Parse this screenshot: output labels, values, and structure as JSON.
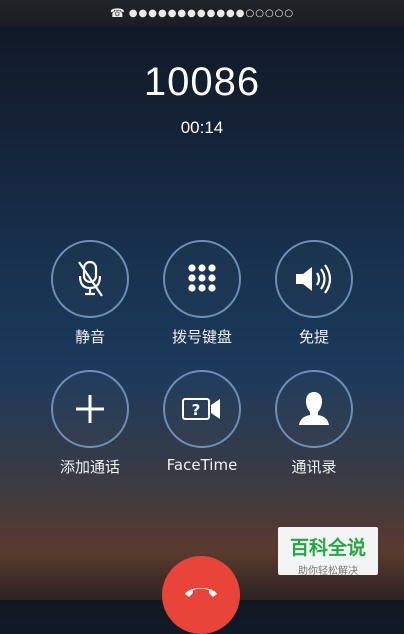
{
  "status_bar": {
    "icon": "phone-handset-icon",
    "signal_dots": "●●●●●●●●●●●●○○○○○"
  },
  "call": {
    "number": "10086",
    "duration": "00:14"
  },
  "buttons": [
    {
      "label": "静音",
      "icon": "mute-microphone-icon"
    },
    {
      "label": "拨号键盘",
      "icon": "keypad-icon"
    },
    {
      "label": "免提",
      "icon": "speaker-icon"
    },
    {
      "label": "添加通话",
      "icon": "add-call-icon"
    },
    {
      "label": "FaceTime",
      "icon": "facetime-icon"
    },
    {
      "label": "通讯录",
      "icon": "contacts-icon"
    }
  ],
  "end_call": {
    "icon": "end-call-icon",
    "color": "#e8443a"
  },
  "watermark": {
    "title": "百科全说",
    "subtitle": "助你轻松解决"
  },
  "colors": {
    "ring": "#6f8fb5",
    "end_call": "#e8443a",
    "watermark_green": "#23a844"
  }
}
